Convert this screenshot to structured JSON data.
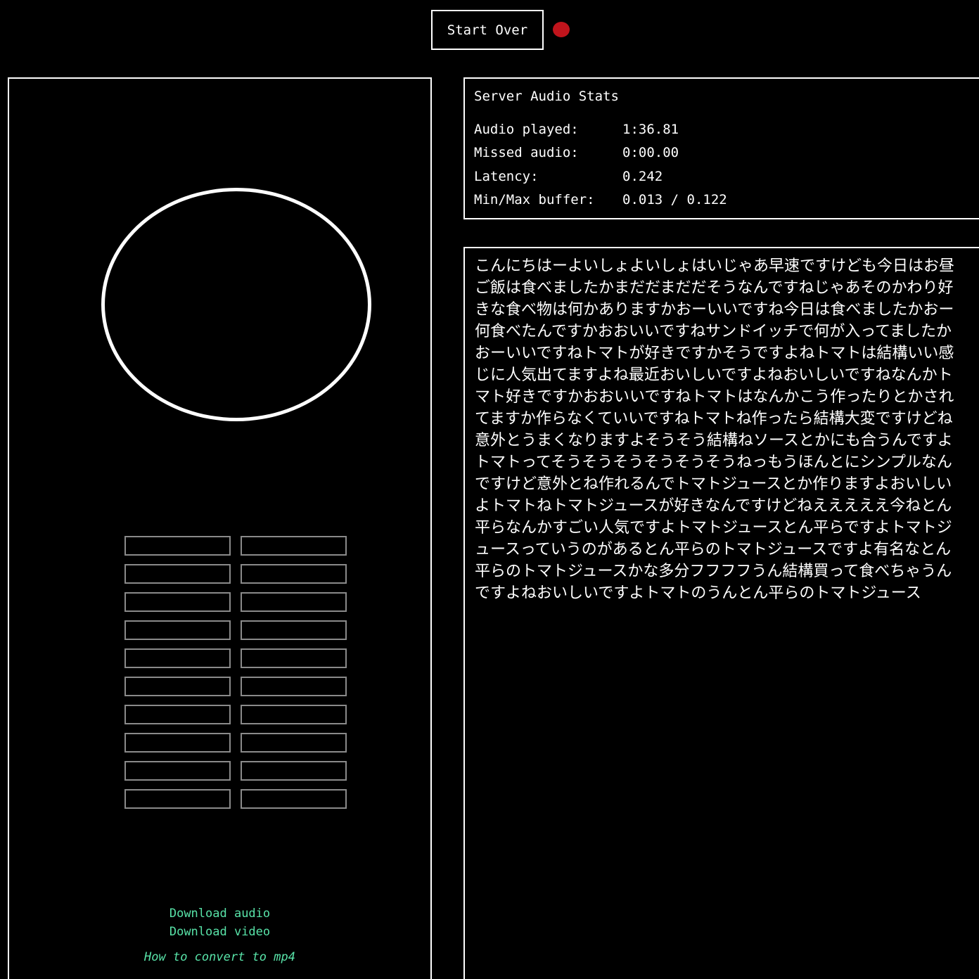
{
  "toolbar": {
    "start_over_label": "Start Over",
    "recording_indicator_color": "#c0141c"
  },
  "meters": {
    "columns": 2,
    "rows": 10,
    "border_color": "#8a8a8a"
  },
  "links": {
    "download_audio": "Download audio",
    "download_video": "Download video",
    "how_to_convert": "How to convert to mp4",
    "color": "#58e3a8"
  },
  "stats": {
    "title": "Server Audio Stats",
    "rows": [
      {
        "label": "Audio played:",
        "value": "1:36.81"
      },
      {
        "label": "Missed audio:",
        "value": "0:00.00"
      },
      {
        "label": "Latency:",
        "value": "0.242"
      },
      {
        "label": "Min/Max buffer:",
        "value": "0.013 / 0.122"
      }
    ]
  },
  "transcript": {
    "text": "こんにちはーよいしょよいしょはいじゃあ早速ですけども今日はお昼ご飯は食べましたかまだだまだだそうなんですねじゃあそのかわり好きな食べ物は何かありますかおーいいですね今日は食べましたかおー何食べたんですかおおいいですねサンドイッチで何が入ってましたかおーいいですねトマトが好きですかそうですよねトマトは結構いい感じに人気出てますよね最近おいしいですよねおいしいですねなんかトマト好きですかおおいいですねトマトはなんかこう作ったりとかされてますか作らなくていいですねトマトね作ったら結構大変ですけどね意外とうまくなりますよそうそう結構ねソースとかにも合うんですよトマトってそうそうそうそうそうそうねっもうほんとにシンプルなんですけど意外とね作れるんでトマトジュースとか作りますよおいしいよトマトねトマトジュースが好きなんですけどねえええええ今ねとん平らなんかすごい人気ですよトマトジュースとん平らですよトマトジュースっていうのがあるとん平らのトマトジュースですよ有名なとん平らのトマトジュースかな多分フフフフうん結構買って食べちゃうんですよねおいしいですよトマトのうんとん平らのトマトジュース"
  }
}
